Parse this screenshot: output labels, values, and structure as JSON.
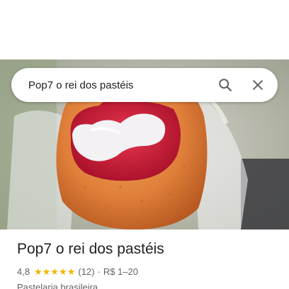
{
  "search": {
    "query": "Pop7 o rei dos pastéis",
    "search_icon": "search-icon",
    "close_icon": "close-icon"
  },
  "place": {
    "photo_description": "food-photo",
    "title": "Pop7 o rei dos pastéis",
    "rating": "4,8",
    "stars": 5,
    "review_count": "(12)",
    "separator": "·",
    "price": "R$ 1–20",
    "category": "Pastelaria brasileira"
  },
  "colors": {
    "star": "#f4b400",
    "text_primary": "#202124",
    "text_secondary": "#5f6368"
  }
}
